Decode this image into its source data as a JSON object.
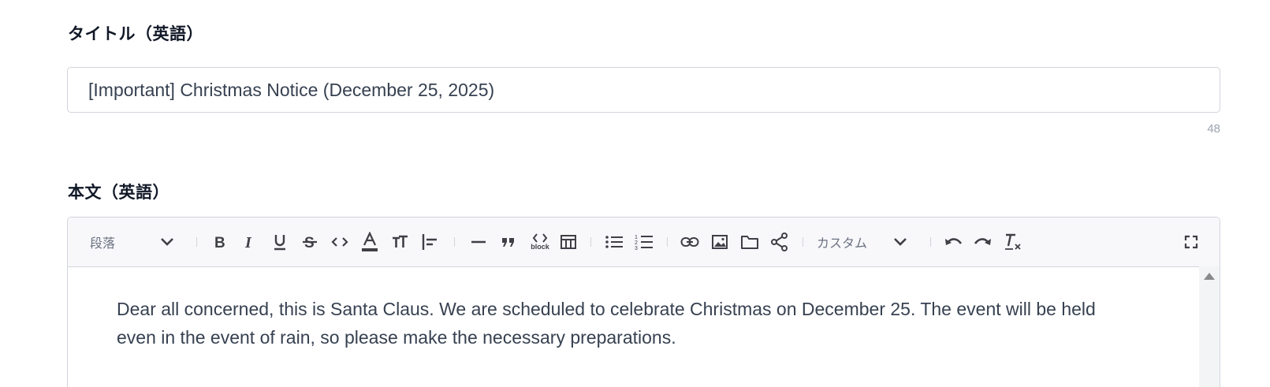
{
  "title_field": {
    "label": "タイトル（英語）",
    "value": "[Important] Christmas Notice (December 25, 2025)",
    "char_count": "48"
  },
  "body_field": {
    "label": "本文（英語）",
    "toolbar": {
      "paragraph_select": "段落",
      "custom_select": "カスタム",
      "icons": [
        "chevron-down-icon",
        "bold-icon",
        "italic-icon",
        "underline-icon",
        "strikethrough-icon",
        "code-icon",
        "font-color-icon",
        "font-size-icon",
        "align-left-icon",
        "horizontal-line-icon",
        "blockquote-icon",
        "code-block-icon",
        "table-icon",
        "bulleted-list-icon",
        "numbered-list-icon",
        "link-icon",
        "image-icon",
        "folder-icon",
        "share-icon",
        "undo-icon",
        "redo-icon",
        "remove-format-icon",
        "fullscreen-icon"
      ],
      "code_block_caption": "block"
    },
    "content": "Dear all concerned, this is Santa Claus. We are scheduled to celebrate Christmas on December 25. The event will be held even in the event of rain, so please make the necessary preparations."
  }
}
